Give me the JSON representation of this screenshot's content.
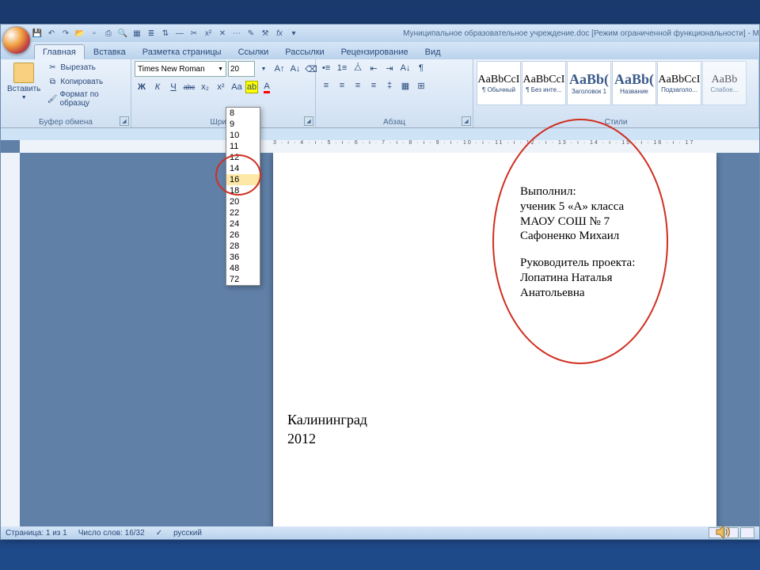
{
  "title": "Муниципальное образовательное учреждение.doc [Режим ограниченной функциональности] - M",
  "qat_icons": [
    "save-icon",
    "undo-icon",
    "redo-icon",
    "open-icon",
    "new-icon",
    "print-icon",
    "preview-icon",
    "table-icon",
    "col-icon",
    "sort-icon",
    "dash-icon",
    "cut-icon",
    "func-icon",
    "sup-icon",
    "cross-icon",
    "dots-icon",
    "marker-icon",
    "build-icon",
    "fx-icon"
  ],
  "tabs": [
    "Главная",
    "Вставка",
    "Разметка страницы",
    "Ссылки",
    "Рассылки",
    "Рецензирование",
    "Вид"
  ],
  "ribbon": {
    "clipboard": {
      "title": "Буфер обмена",
      "paste": "Вставить",
      "cut": "Вырезать",
      "copy": "Копировать",
      "format": "Формат по образцу"
    },
    "font": {
      "title": "Шрифт",
      "name": "Times New Roman",
      "size": "20",
      "bold": "Ж",
      "italic": "К",
      "underline": "Ч",
      "strike": "abc"
    },
    "para": {
      "title": "Абзац"
    },
    "styles": {
      "title": "Стили",
      "items": [
        {
          "prev": "AaBbCcI",
          "lbl": "¶ Обычный"
        },
        {
          "prev": "AaBbCcI",
          "lbl": "¶ Без инте..."
        },
        {
          "prev": "AaBb(",
          "lbl": "Заголовок 1",
          "big": true
        },
        {
          "prev": "AaBb(",
          "lbl": "Название",
          "big": true
        },
        {
          "prev": "AaBbCcI",
          "lbl": "Подзаголо..."
        },
        {
          "prev": "AaBb",
          "lbl": "Слабое...",
          "faint": true
        }
      ]
    }
  },
  "size_dropdown": [
    "8",
    "9",
    "10",
    "11",
    "12",
    "14",
    "16",
    "18",
    "20",
    "22",
    "24",
    "26",
    "28",
    "36",
    "48",
    "72"
  ],
  "size_selected": "16",
  "document": {
    "block1": [
      "Выполнил:",
      "ученик 5 «А» класса",
      "МАОУ СОШ № 7",
      "Сафоненко Михаил"
    ],
    "block2": [
      "Руководитель проекта:",
      "Лопатина Наталья",
      "Анатольевна"
    ],
    "city": "Калининград",
    "year": "2012"
  },
  "ruler_h": "3 · ı · 4 · ı · 5 · ı · 6 · ı · 7 · ı · 8 · ı · 9 · ı · 10 · ı · 11 · ı · 12 · ı · 13 · ı · 14 · ı · 15 · ı · 16 · ı · 17",
  "status": {
    "page": "Страница: 1 из 1",
    "words": "Число слов: 16/32",
    "lang": "русский"
  }
}
